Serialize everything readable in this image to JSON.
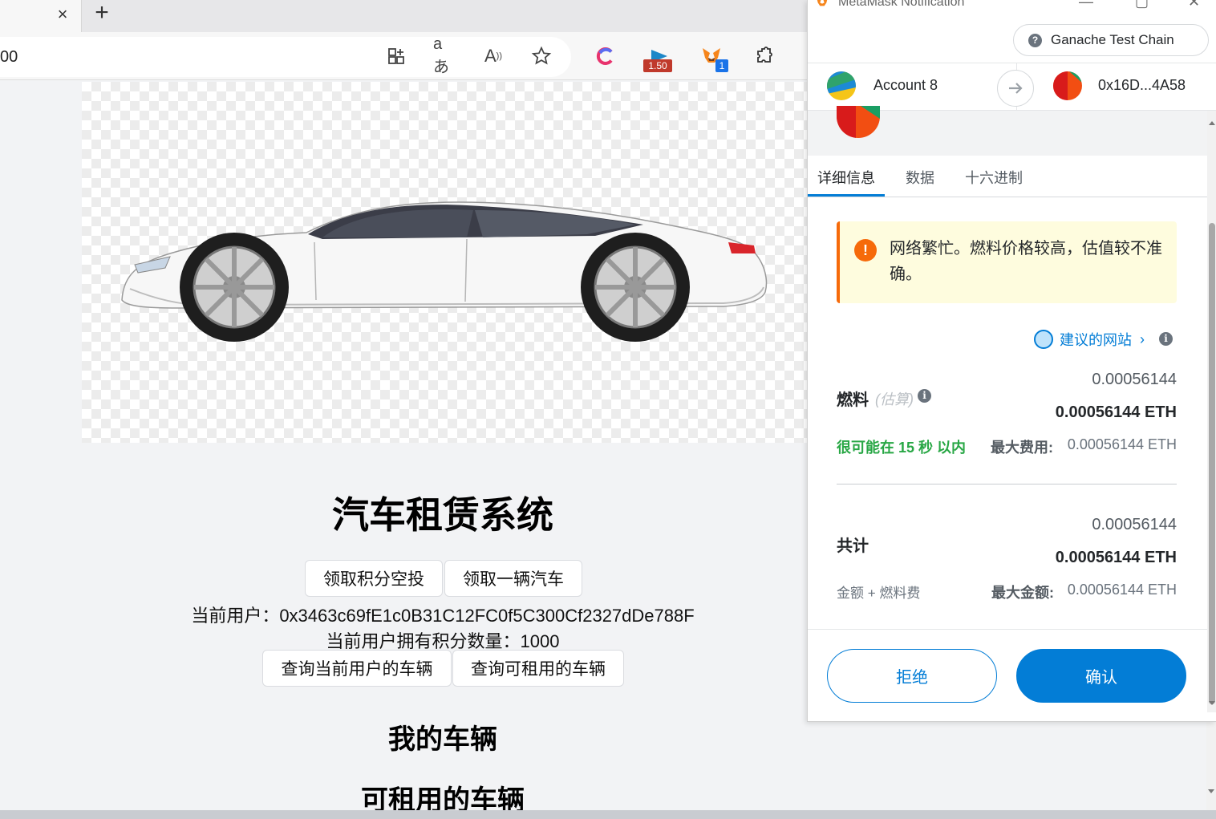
{
  "browser": {
    "tab_close": "×",
    "new_tab": "+",
    "address_text": "00",
    "icons": [
      "apps-icon",
      "translate-icon",
      "read-aloud-icon",
      "favorite-star-icon",
      "c-extension-icon",
      "speed-extension-icon",
      "metamask-extension-icon",
      "extensions-puzzle-icon"
    ],
    "speed_badge": "1.50",
    "metamask_badge": "1"
  },
  "page": {
    "title": "汽车租赁系统",
    "airdrop_button": "领取积分空投",
    "claim_car_button": "领取一辆汽车",
    "current_user": "当前用户：0x3463c69fE1c0B31C12FC0f5C300Cf2327dDe788F",
    "points": "当前用户拥有积分数量：1000",
    "query_my_cars_button": "查询当前用户的车辆",
    "query_available_cars_button": "查询可租用的车辆",
    "my_cars_heading": "我的车辆",
    "available_cars_heading": "可租用的车辆"
  },
  "metamask": {
    "window_title": "MetaMask Notification",
    "network": "Ganache Test Chain",
    "from_account": "Account 8",
    "to_address": "0x16D...4A58",
    "tabs": [
      "详细信息",
      "数据",
      "十六进制"
    ],
    "warning": "网络繁忙。燃料价格较高，估值较不准确。",
    "suggested_site": "建议的网站",
    "gas_label": "燃料",
    "gas_estimate_label": "(估算)",
    "gas_value": "0.00056144",
    "gas_value_eth": "0.00056144 ETH",
    "timing": "很可能在 15 秒 以内",
    "max_fee_label": "最大费用:",
    "max_fee_value": "0.00056144 ETH",
    "total_label": "共计",
    "total_value": "0.00056144",
    "total_value_eth": "0.00056144 ETH",
    "amount_plus_gas": "金额 + 燃料费",
    "max_amount_label": "最大金额:",
    "max_amount_value": "0.00056144 ETH",
    "reject_button": "拒绝",
    "confirm_button": "确认"
  },
  "colors": {
    "accent_blue": "#037dd6",
    "warning_orange": "#f66a0a",
    "success_green": "#28a745"
  }
}
